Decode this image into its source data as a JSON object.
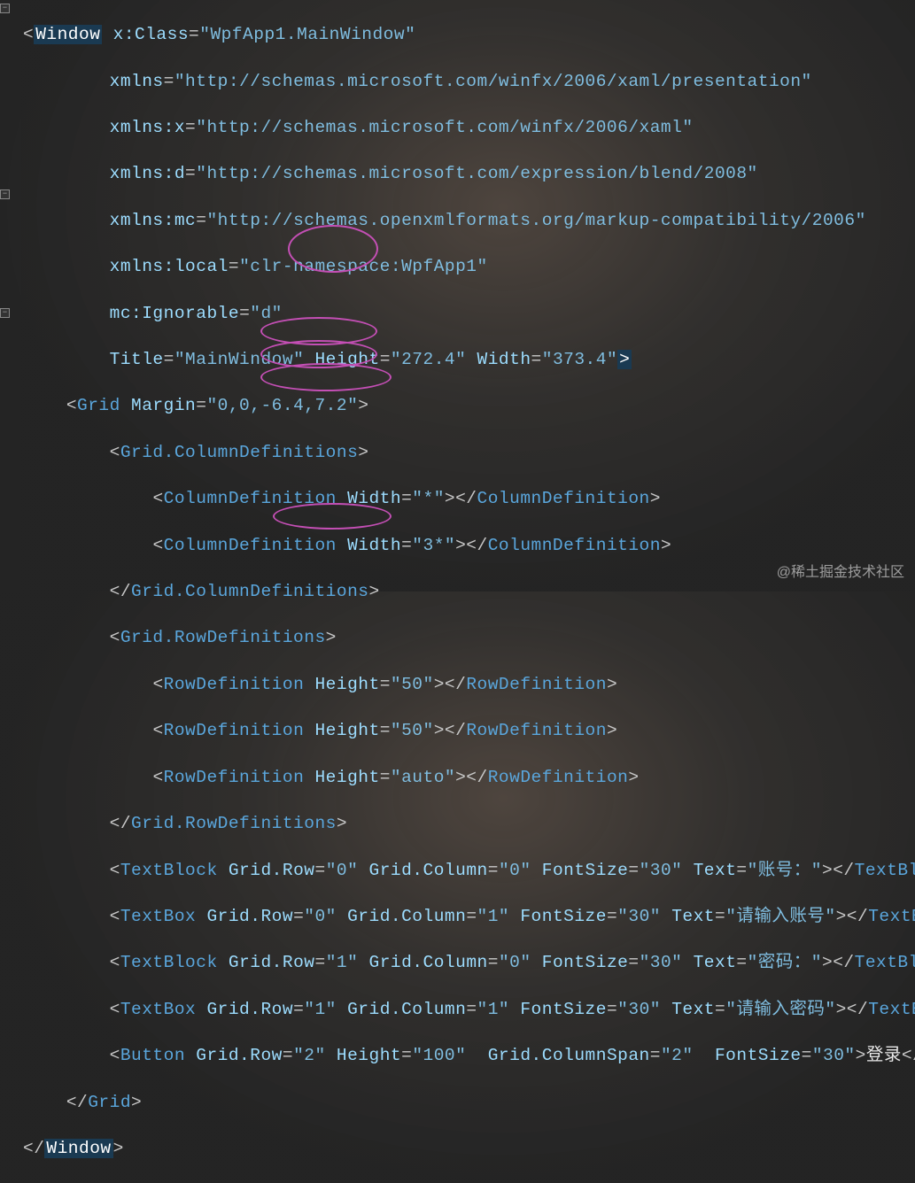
{
  "window": {
    "tag_open": "Window",
    "xClass_attr": "x:Class",
    "xClass_val": "\"WpfApp1.MainWindow\"",
    "ns_plain_attr": "xmlns",
    "ns_plain_val": "\"http://schemas.microsoft.com/winfx/2006/xaml/presentation\"",
    "ns_x_attr": "xmlns:x",
    "ns_x_val": "\"http://schemas.microsoft.com/winfx/2006/xaml\"",
    "ns_d_attr": "xmlns:d",
    "ns_d_val": "\"http://schemas.openxmlformats.org/markup-compatibility/2006\"",
    "ns_d_url": "\"http://schemas.microsoft.com/expression/blend/2008\"",
    "ns_mc_attr": "xmlns:mc",
    "ns_mc_val": "\"http://schemas.openxmlformats.org/markup-compatibility/2006\"",
    "ns_local_attr": "xmlns:local",
    "ns_local_val": "\"clr-namespace:WpfApp1\"",
    "mc_ign_attr": "mc:Ignorable",
    "mc_ign_val": "\"d\"",
    "title_attr": "Title",
    "title_val": "\"MainWindow\"",
    "height_attr": "Height",
    "height_val": "\"272.4\"",
    "width_attr": "Width",
    "width_val": "\"373.4\""
  },
  "grid": {
    "tag": "Grid",
    "margin_attr": "Margin",
    "margin_val": "\"0,0,-6.4,7.2\"",
    "coldefs_tag": "Grid.ColumnDefinitions",
    "coldef_tag": "ColumnDefinition",
    "col_w_attr": "Width",
    "col_w1": "\"*\"",
    "col_w2": "\"3*\"",
    "rowdefs_tag": "Grid.RowDefinitions",
    "rowdef_tag": "RowDefinition",
    "row_h_attr": "Height",
    "row_h1": "\"50\"",
    "row_h2": "\"50\"",
    "row_h3": "\"auto\""
  },
  "controls": {
    "textblock_tag": "TextBlock",
    "textbox_tag": "TextBox",
    "button_tag": "Button",
    "gridrow_attr": "Grid.Row",
    "gridcol_attr": "Grid.Column",
    "gridspan_attr": "Grid.ColumnSpan",
    "fontsize_attr": "FontSize",
    "text_attr": "Text",
    "height_attr": "Height",
    "row0": "\"0\"",
    "row1": "\"1\"",
    "row2": "\"2\"",
    "col0": "\"0\"",
    "col1": "\"1\"",
    "span2": "\"2\"",
    "fs30": "\"30\"",
    "h100": "\"100\"",
    "txt_user_lbl": "\"账号：\"",
    "txt_user_ph": "\"请输入账号\"",
    "txt_pwd_lbl": "\"密码：\"",
    "txt_pwd_ph": "\"请输入密码\"",
    "btn_text": "登录"
  },
  "watermark": "@稀土掘金技术社区",
  "fold_glyph": "−"
}
